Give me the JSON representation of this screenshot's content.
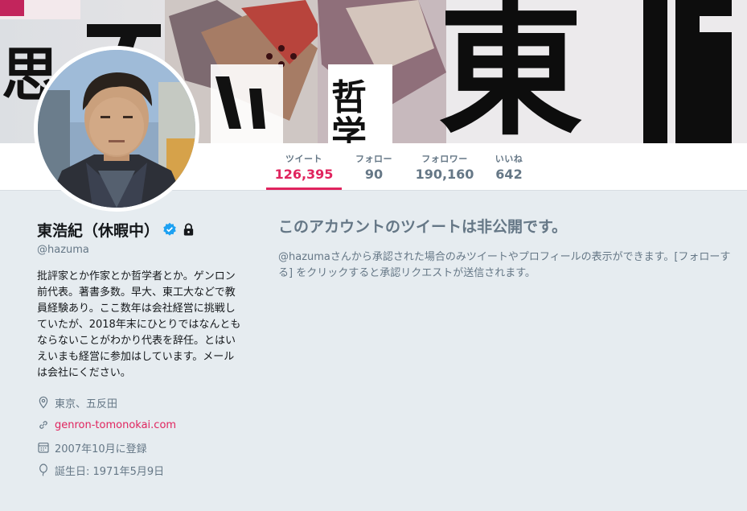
{
  "banner": {
    "description_chars": [
      "思",
      "ア",
      "い",
      "哲",
      "学",
      "東"
    ]
  },
  "stats": [
    {
      "label": "ツイート",
      "value": "126,395",
      "active": true
    },
    {
      "label": "フォロー",
      "value": "90",
      "active": false
    },
    {
      "label": "フォロワー",
      "value": "190,160",
      "active": false
    },
    {
      "label": "いいね",
      "value": "642",
      "active": false
    }
  ],
  "profile": {
    "name": "東浩紀（休暇中）",
    "handle": "@hazuma",
    "bio": "批評家とか作家とか哲学者とか。ゲンロン前代表。著書多数。早大、東工大などで教員経験あり。ここ数年は会社経営に挑戦していたが、2018年末にひとりではなんともならないことがわかり代表を辞任。とはいえいまも経営に参加はしています。メールは会社にください。",
    "location": "東京、五反田",
    "url": "genron-tomonokai.com",
    "joined": "2007年10月に登録",
    "birthday": "誕生日: 1971年5月9日"
  },
  "private_notice": {
    "title": "このアカウントのツイートは非公開です。",
    "body": "@hazumaさんから承認された場合のみツイートやプロフィールの表示ができます。[フォローする] をクリックすると承認リクエストが送信されます。"
  },
  "colors": {
    "accent": "#e0245e",
    "muted": "#657786",
    "background": "#e6ecf0",
    "verified": "#1da1f2"
  }
}
